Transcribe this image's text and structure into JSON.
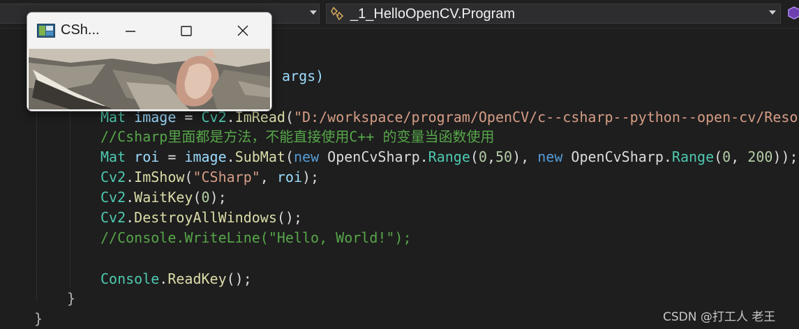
{
  "navigation": {
    "class_dropdown": {
      "value": "_1_HelloOpenCV.Program",
      "icon": "class-icon"
    }
  },
  "code": {
    "line_args": "args)",
    "line_imread": {
      "type": "Mat",
      "var": "image",
      "op": " = ",
      "cls": "Cv2",
      "fn": "ImRead",
      "str": "\"D:/workspace/program/OpenCV/c--csharp--python--open-cv/Resour"
    },
    "comment_1": "//Csharp里面都是方法，不能直接使用C++ 的变量当函数使用",
    "line_submat": {
      "type": "Mat",
      "var": "roi",
      "op": " = ",
      "obj": "image",
      "fn": "SubMat",
      "new1": "new",
      "ns1": "OpenCvSharp",
      "cls1": "Range",
      "a1": "0",
      "b1": "50",
      "new2": "new",
      "ns2": "OpenCvSharp",
      "cls2": "Range",
      "a2": "0",
      "b2": " 200"
    },
    "line_imshow": {
      "cls": "Cv2",
      "fn": "ImShow",
      "str": "\"CSharp\"",
      "arg": "roi"
    },
    "line_waitkey": {
      "cls": "Cv2",
      "fn": "WaitKey",
      "arg": "0"
    },
    "line_destroy": {
      "cls": "Cv2",
      "fn": "DestroyAllWindows"
    },
    "comment_2": "//Console.WriteLine(\"Hello, World!\");",
    "line_readkey": {
      "cls": "Console",
      "fn": "ReadKey"
    },
    "close_brace_method": "}",
    "close_brace_class": "}"
  },
  "cv_window": {
    "title": "CSh...",
    "icons": [
      "app-icon",
      "minimize-icon",
      "maximize-icon",
      "close-icon"
    ]
  },
  "watermark": "CSDN @打工人 老王",
  "colors": {
    "background": "#1e1e1e",
    "keyword": "#569cd6",
    "type": "#4ec9b0",
    "variable": "#9cdcfe",
    "method": "#dcdcaa",
    "string": "#d69d85",
    "number": "#b5cea8",
    "comment": "#57a64a"
  }
}
